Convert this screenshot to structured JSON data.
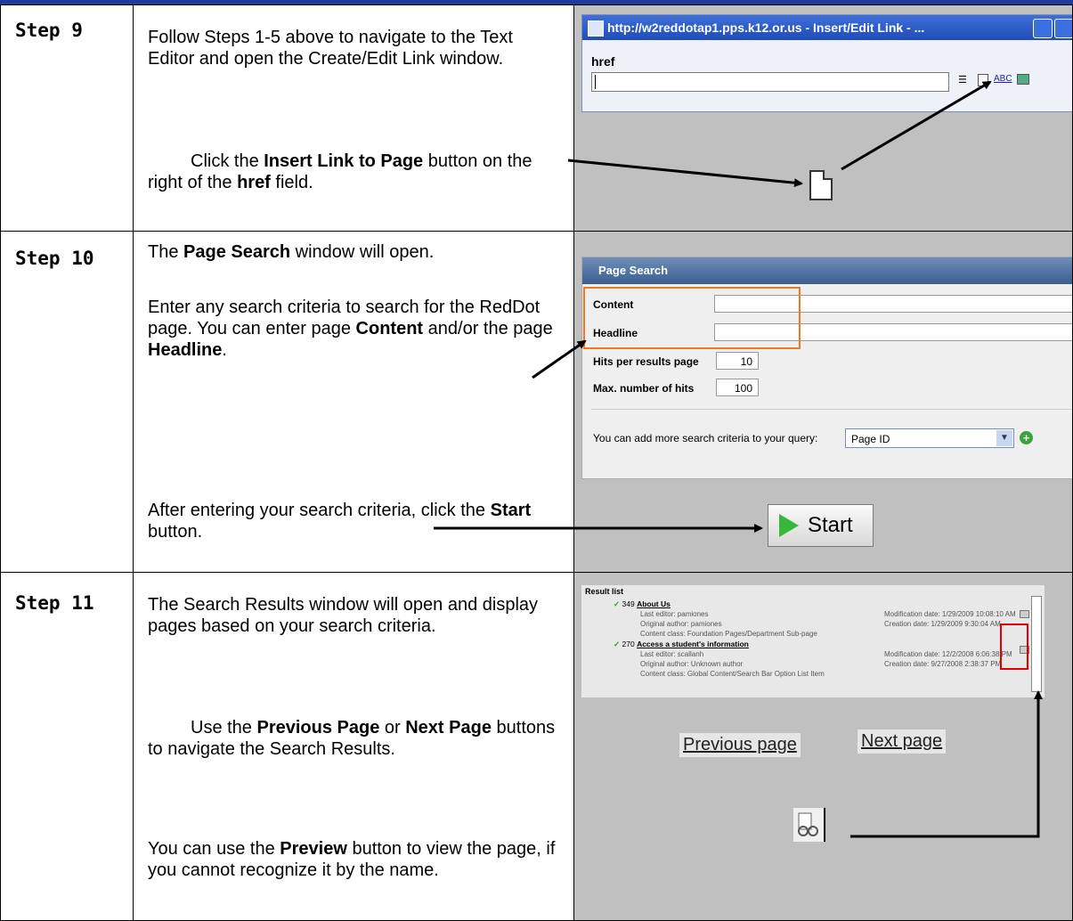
{
  "rows": [
    {
      "step": "Step 9",
      "para1": "Follow Steps 1-5 above to navigate to the Text Editor and open the Create/Edit Link window.",
      "para2": {
        "a": "Click the ",
        "b1": "Insert Link to Page",
        "c": " button on the right of the ",
        "b2": "href",
        "d": " field."
      },
      "shot": {
        "window_title": "http://w2reddotap1.pps.k12.or.us - Insert/Edit Link - ...",
        "field_label": "href",
        "toolbar_abc": "ABC"
      }
    },
    {
      "step": "Step 10",
      "para1": {
        "a": "The ",
        "b": "Page Search",
        "c": " window will open."
      },
      "para2": {
        "a": "Enter any search criteria to search for the RedDot page.  You can enter page ",
        "b1": "Content",
        "c": " and/or the page ",
        "b2": "Headline",
        "d": "."
      },
      "para3": {
        "a": "After entering your search criteria, click the ",
        "b": "Start",
        "c": " button."
      },
      "shot": {
        "panel_title": "Page Search",
        "content_label": "Content",
        "headline_label": "Headline",
        "hits_label": "Hits per results page",
        "hits_value": "10",
        "max_label": "Max. number of hits",
        "max_value": "100",
        "add_note": "You can add more search criteria to your query:",
        "select_value": "Page ID",
        "start_label": "Start"
      }
    },
    {
      "step": "Step 11",
      "para1": "The Search Results window will open and display pages based on your search criteria.",
      "para2": {
        "a": "Use the ",
        "b1": "Previous Page",
        "c": " or ",
        "b2": "Next Page",
        "d": " buttons to navigate the Search Results."
      },
      "para3": {
        "a": "You can use the ",
        "b": "Preview",
        "c": " button to view the page, if you cannot recognize it by the name."
      },
      "shot": {
        "list_title": "Result list",
        "r1_id": "349",
        "r1_name": "About Us",
        "r1_l1": "Last editor: pamiones",
        "r1_l2": "Original author: pamiones",
        "r1_l3": "Content class: Foundation Pages/Department Sub-page",
        "r1_mod": "Modification date: 1/29/2009 10:08:10 AM",
        "r1_cre": "Creation date: 1/29/2009 9:30:04 AM",
        "r2_id": "270",
        "r2_name": "Access a student's information",
        "r2_l1": "Last editor: scallanh",
        "r2_l2": "Original author: Unknown author",
        "r2_l3": "Content class: Global Content/Search Bar Option List Item",
        "r2_mod": "Modification date: 12/2/2008 6:06:38 PM",
        "r2_cre": "Creation date: 9/27/2008 2:38:37 PM",
        "prev_label": "Previous page",
        "next_label": "Next page"
      }
    }
  ]
}
